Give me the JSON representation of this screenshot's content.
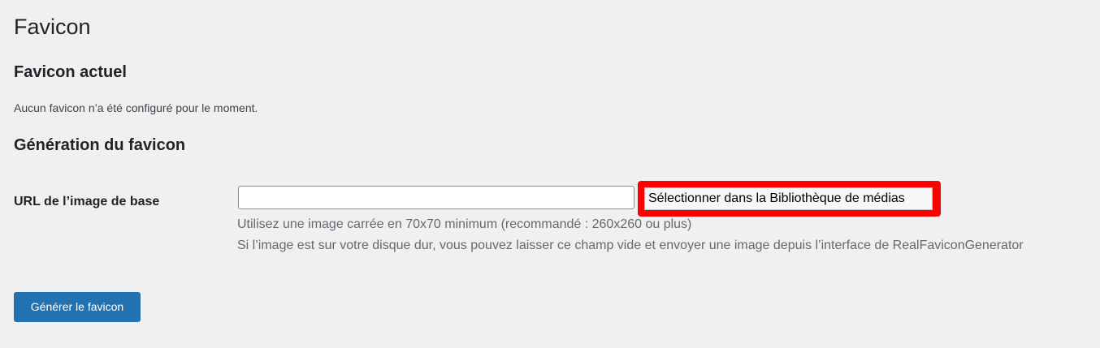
{
  "page": {
    "title": "Favicon"
  },
  "current_section": {
    "title": "Favicon actuel",
    "message": "Aucun favicon n’a été configuré pour le moment."
  },
  "generation_section": {
    "title": "Génération du favicon",
    "url_label": "URL de l’image de base",
    "url_value": "",
    "media_button_label": "Sélectionner dans la Bibliothèque de médias",
    "description_line_1": "Utilisez une image carrée en 70x70 minimum (recommandé : 260x260 ou plus)",
    "description_line_2": "Si l’image est sur votre disque dur, vous pouvez laisser ce champ vide et envoyer une image depuis l’interface de RealFaviconGenerator"
  },
  "actions": {
    "generate_label": "Générer le favicon"
  },
  "colors": {
    "background": "#f0f0f1",
    "primary": "#2271b1",
    "highlight": "#ff0000",
    "description_text": "#646970"
  }
}
